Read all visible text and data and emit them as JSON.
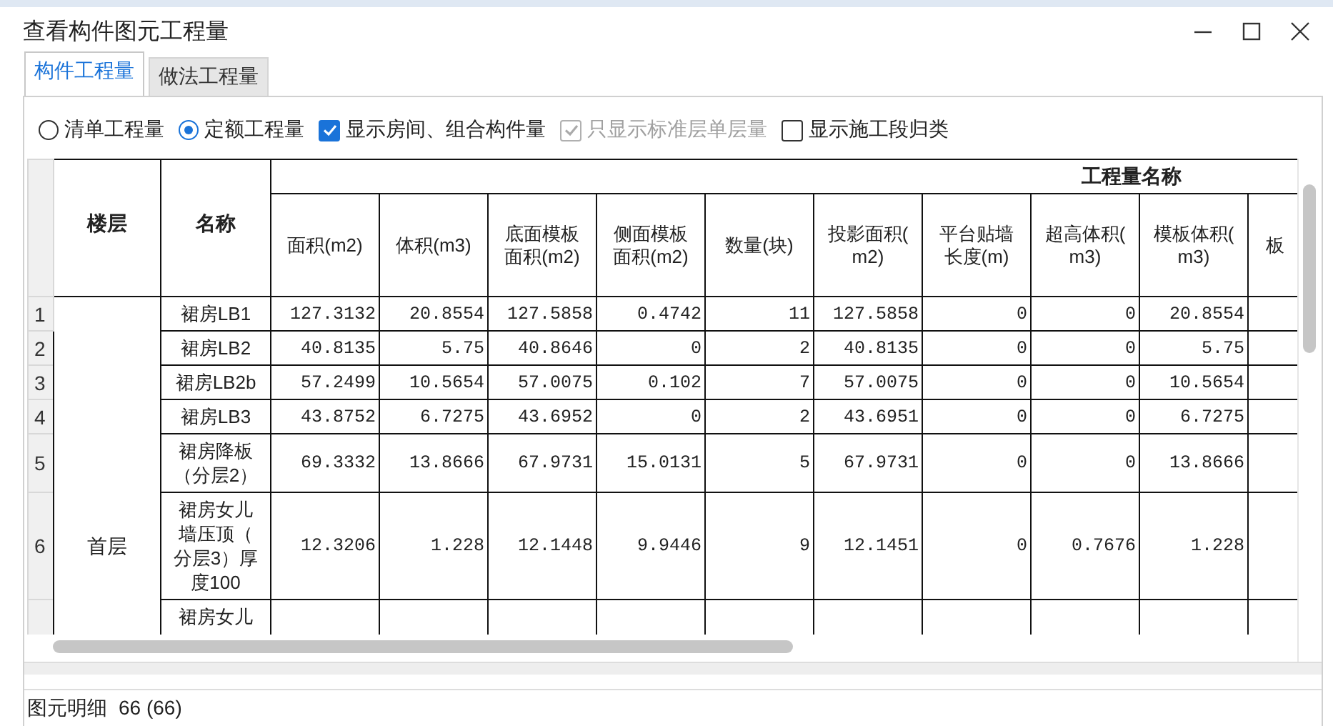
{
  "window": {
    "title": "查看构件图元工程量"
  },
  "tabs": [
    {
      "label": "构件工程量",
      "selected": true
    },
    {
      "label": "做法工程量",
      "selected": false
    }
  ],
  "options": [
    {
      "kind": "radio",
      "label": "清单工程量",
      "selected": false
    },
    {
      "kind": "radio",
      "label": "定额工程量",
      "selected": true
    },
    {
      "kind": "checkbox",
      "label": "显示房间、组合构件量",
      "checked": true,
      "disabled": false
    },
    {
      "kind": "checkbox",
      "label": "只显示标准层单层量",
      "checked": true,
      "disabled": true
    },
    {
      "kind": "checkbox",
      "label": "显示施工段归类",
      "checked": false,
      "disabled": false
    }
  ],
  "table": {
    "fixed_columns": [
      "楼层",
      "名称"
    ],
    "group_header": "工程量名称",
    "columns": [
      "面积(m2)",
      "体积(m3)",
      "底面模板面积(m2)",
      "侧面模板面积(m2)",
      "数量(块)",
      "投影面积(m2)",
      "平台贴墙长度(m)",
      "超高体积(m3)",
      "模板体积(m3)",
      "板"
    ],
    "groups": [
      {
        "floor": "首层",
        "rows": [
          {
            "number": "1",
            "name": "裙房LB1",
            "cells": [
              "127.3132",
              "20.8554",
              "127.5858",
              "0.4742",
              "11",
              "127.5858",
              "0",
              "0",
              "20.8554"
            ]
          },
          {
            "number": "2",
            "name": "裙房LB2",
            "cells": [
              "40.8135",
              "5.75",
              "40.8646",
              "0",
              "2",
              "40.8135",
              "0",
              "0",
              "5.75"
            ]
          },
          {
            "number": "3",
            "name": "裙房LB2b",
            "cells": [
              "57.2499",
              "10.5654",
              "57.0075",
              "0.102",
              "7",
              "57.0075",
              "0",
              "0",
              "10.5654"
            ]
          },
          {
            "number": "4",
            "name": "裙房LB3",
            "cells": [
              "43.8752",
              "6.7275",
              "43.6952",
              "0",
              "2",
              "43.6951",
              "0",
              "0",
              "6.7275"
            ]
          },
          {
            "number": "5",
            "name": "裙房降板（分层2）",
            "cells": [
              "69.3332",
              "13.8666",
              "67.9731",
              "15.0131",
              "5",
              "67.9731",
              "0",
              "0",
              "13.8666"
            ]
          },
          {
            "number": "6",
            "name": "裙房女儿墙压顶（分层3）厚度100",
            "cells": [
              "12.3206",
              "1.228",
              "12.1448",
              "9.9446",
              "9",
              "12.1451",
              "0",
              "0.7676",
              "1.228"
            ]
          },
          {
            "name": "裙房女儿",
            "cells": []
          }
        ]
      }
    ]
  },
  "detail": {
    "label": "图元明细",
    "count": "66 (66)"
  }
}
